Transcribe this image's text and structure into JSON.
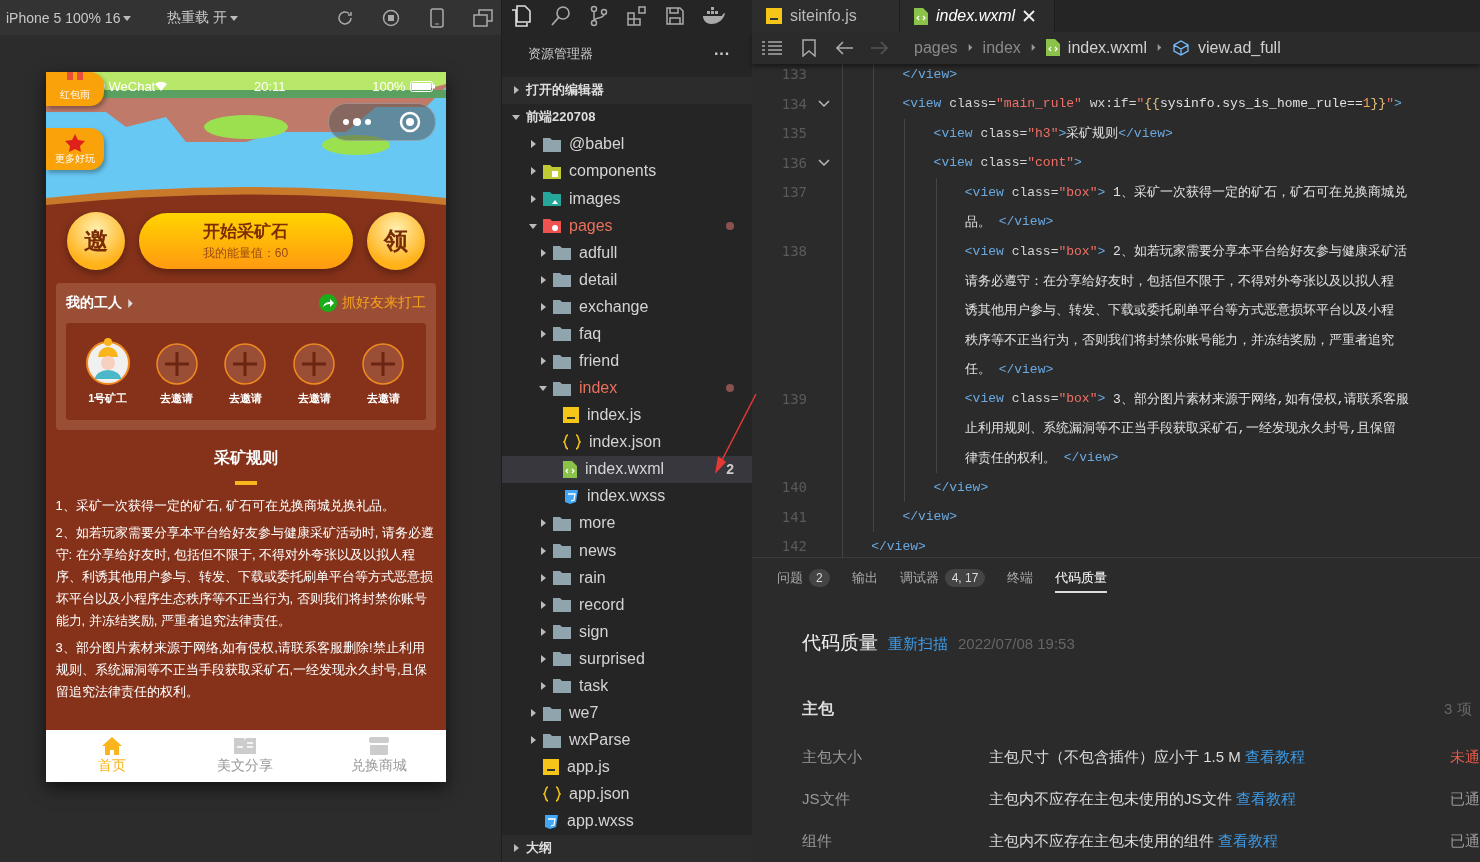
{
  "simulator": {
    "device": "iPhone 5 100% 16",
    "hot_reload": "热重载 开",
    "phone": {
      "status": {
        "carrier": "WeChat",
        "time": "20:11",
        "battery": "100%"
      },
      "badges": [
        {
          "label": "红包雨",
          "kind": "ribbon"
        },
        {
          "label": "更多好玩",
          "kind": "star"
        }
      ],
      "actions": {
        "left": "邀",
        "main": "开始采矿石",
        "energy": "我的能量值：60",
        "right": "领"
      },
      "workers": {
        "title": "我的工人",
        "share": "抓好友来打工",
        "items": [
          {
            "label": "1号矿工",
            "kind": "worker"
          },
          {
            "label": "去邀请",
            "kind": "invite"
          },
          {
            "label": "去邀请",
            "kind": "invite"
          },
          {
            "label": "去邀请",
            "kind": "invite"
          },
          {
            "label": "去邀请",
            "kind": "invite"
          }
        ]
      },
      "rules": {
        "title": "采矿规则",
        "paragraphs": [
          "1、采矿一次获得一定的矿石, 矿石可在兑换商城兑换礼品。",
          "2、如若玩家需要分享本平台给好友参与健康采矿活动时, 请务必遵守: 在分享给好友时, 包括但不限于, 不得对外夸张以及以拟人程序、利诱其他用户参与、转发、下载或委托刷单平台等方式恶意损坏平台以及小程序生态秩序等不正当行为, 否则我们将封禁你账号能力, 并冻结奖励, 严重者追究法律责任。",
          "3、部分图片素材来源于网络,如有侵权,请联系客服删除!禁止利用规则、系统漏洞等不正当手段获取采矿石,一经发现永久封号,且保留追究法律责任的权利。"
        ]
      },
      "tabbar": [
        {
          "label": "首页",
          "kind": "home",
          "selected": true
        },
        {
          "label": "美文分享",
          "kind": "article",
          "selected": false
        },
        {
          "label": "兑换商城",
          "kind": "shop",
          "selected": false
        }
      ]
    }
  },
  "explorer": {
    "title": "资源管理器",
    "more": "···",
    "sections": [
      {
        "label": "打开的编辑器",
        "expanded": false
      },
      {
        "label": "前端220708",
        "expanded": true,
        "children": [
          {
            "name": "@babel",
            "kind": "folder",
            "expanded": false,
            "selected": false
          },
          {
            "name": "components",
            "kind": "folder-components",
            "expanded": false,
            "selected": false
          },
          {
            "name": "images",
            "kind": "folder-images",
            "expanded": false,
            "selected": false
          },
          {
            "name": "pages",
            "kind": "folder-pages",
            "expanded": true,
            "modified": true,
            "selected": false,
            "children": [
              {
                "name": "adfull",
                "kind": "folder",
                "expanded": false,
                "selected": false
              },
              {
                "name": "detail",
                "kind": "folder",
                "expanded": false,
                "selected": false
              },
              {
                "name": "exchange",
                "kind": "folder",
                "expanded": false,
                "selected": false
              },
              {
                "name": "faq",
                "kind": "folder",
                "expanded": false,
                "selected": false
              },
              {
                "name": "friend",
                "kind": "folder",
                "expanded": false,
                "selected": false
              },
              {
                "name": "index",
                "kind": "folder",
                "expanded": true,
                "modified": true,
                "selected": false,
                "children": [
                  {
                    "name": "index.js",
                    "kind": "js",
                    "selected": false
                  },
                  {
                    "name": "index.json",
                    "kind": "json",
                    "selected": false
                  },
                  {
                    "name": "index.wxml",
                    "kind": "wxml",
                    "selected": true,
                    "badge": "2"
                  },
                  {
                    "name": "index.wxss",
                    "kind": "wxss",
                    "selected": false
                  }
                ]
              },
              {
                "name": "more",
                "kind": "folder",
                "expanded": false,
                "selected": false
              },
              {
                "name": "news",
                "kind": "folder",
                "expanded": false,
                "selected": false
              },
              {
                "name": "rain",
                "kind": "folder",
                "expanded": false,
                "selected": false
              },
              {
                "name": "record",
                "kind": "folder",
                "expanded": false,
                "selected": false
              },
              {
                "name": "sign",
                "kind": "folder",
                "expanded": false,
                "selected": false
              },
              {
                "name": "surprised",
                "kind": "folder",
                "expanded": false,
                "selected": false
              },
              {
                "name": "task",
                "kind": "folder",
                "expanded": false,
                "selected": false
              }
            ]
          },
          {
            "name": "we7",
            "kind": "folder",
            "expanded": false,
            "selected": false
          },
          {
            "name": "wxParse",
            "kind": "folder",
            "expanded": false,
            "selected": false
          },
          {
            "name": "app.js",
            "kind": "js",
            "selected": false
          },
          {
            "name": "app.json",
            "kind": "json",
            "selected": false
          },
          {
            "name": "app.wxss",
            "kind": "wxss",
            "selected": false
          }
        ]
      },
      {
        "label": "大纲",
        "expanded": false
      }
    ]
  },
  "editor": {
    "tabs": [
      {
        "label": "siteinfo.js",
        "kind": "js",
        "selected": false
      },
      {
        "label": "index.wxml",
        "kind": "wxml",
        "selected": true
      }
    ],
    "breadcrumb": [
      {
        "label": "pages",
        "kind": "folder"
      },
      {
        "label": "index",
        "kind": "folder"
      },
      {
        "label": "index.wxml",
        "kind": "wxml"
      },
      {
        "label": "view.ad_full",
        "kind": "element"
      }
    ],
    "lines": [
      {
        "number": "133",
        "fold": false,
        "tokens": [
          {
            "kind": "tag",
            "text": "        </view>"
          }
        ]
      },
      {
        "number": "134",
        "fold": true,
        "tokens": [
          {
            "kind": "tag",
            "text": "        <view"
          },
          {
            "kind": "attr",
            "text": " class="
          },
          {
            "kind": "str",
            "text": "\"main_rule\""
          },
          {
            "kind": "attr",
            "text": " wx:if="
          },
          {
            "kind": "str",
            "text": "\""
          },
          {
            "kind": "brace",
            "text": "{{"
          },
          {
            "kind": "text",
            "text": "sysinfo.sys_is_home_rule=="
          },
          {
            "kind": "num",
            "text": "1"
          },
          {
            "kind": "brace",
            "text": "}}"
          },
          {
            "kind": "str",
            "text": "\""
          },
          {
            "kind": "tag",
            "text": ">"
          }
        ]
      },
      {
        "number": "135",
        "fold": false,
        "tokens": [
          {
            "kind": "tag",
            "text": "            <view"
          },
          {
            "kind": "attr",
            "text": " class="
          },
          {
            "kind": "str",
            "text": "\"h3\""
          },
          {
            "kind": "tag",
            "text": ">"
          },
          {
            "kind": "text",
            "text": "采矿规则"
          },
          {
            "kind": "tag",
            "text": "</view>"
          }
        ]
      },
      {
        "number": "136",
        "fold": true,
        "tokens": [
          {
            "kind": "tag",
            "text": "            <view"
          },
          {
            "kind": "attr",
            "text": " class="
          },
          {
            "kind": "str",
            "text": "\"cont\""
          },
          {
            "kind": "tag",
            "text": ">"
          }
        ]
      },
      {
        "number": "137",
        "fold": false,
        "tokens": [
          {
            "kind": "tag",
            "text": "                <view"
          },
          {
            "kind": "attr",
            "text": " class="
          },
          {
            "kind": "str",
            "text": "\"box\""
          },
          {
            "kind": "tag",
            "text": ">"
          },
          {
            "kind": "text",
            "text": " 1、采矿一次获得一定的矿石，矿石可在兑换商城兑"
          }
        ]
      },
      {
        "fold": false,
        "tokens": [
          {
            "kind": "text",
            "text": "                品。 "
          },
          {
            "kind": "tag",
            "text": "</view>"
          }
        ]
      },
      {
        "number": "138",
        "fold": false,
        "tokens": [
          {
            "kind": "tag",
            "text": "                <view"
          },
          {
            "kind": "attr",
            "text": " class="
          },
          {
            "kind": "str",
            "text": "\"box\""
          },
          {
            "kind": "tag",
            "text": ">"
          },
          {
            "kind": "text",
            "text": " 2、如若玩家需要分享本平台给好友参与健康采矿活"
          }
        ]
      },
      {
        "fold": false,
        "tokens": [
          {
            "kind": "text",
            "text": "                请务必遵守：在分享给好友时，包括但不限于，不得对外夸张以及以拟人程"
          }
        ]
      },
      {
        "fold": false,
        "tokens": [
          {
            "kind": "text",
            "text": "                诱其他用户参与、转发、下载或委托刷单平台等方式恶意损坏平台以及小程"
          }
        ]
      },
      {
        "fold": false,
        "tokens": [
          {
            "kind": "text",
            "text": "                秩序等不正当行为，否则我们将封禁你账号能力，并冻结奖励，严重者追究"
          }
        ]
      },
      {
        "fold": false,
        "tokens": [
          {
            "kind": "text",
            "text": "                任。 "
          },
          {
            "kind": "tag",
            "text": "</view>"
          }
        ]
      },
      {
        "number": "139",
        "fold": false,
        "tokens": [
          {
            "kind": "tag",
            "text": "                <view"
          },
          {
            "kind": "attr",
            "text": " class="
          },
          {
            "kind": "str",
            "text": "\"box\""
          },
          {
            "kind": "tag",
            "text": ">"
          },
          {
            "kind": "text",
            "text": " 3、部分图片素材来源于网络,如有侵权,请联系客服"
          }
        ]
      },
      {
        "fold": false,
        "tokens": [
          {
            "kind": "text",
            "text": "                止利用规则、系统漏洞等不正当手段获取采矿石,一经发现永久封号,且保留"
          }
        ]
      },
      {
        "fold": false,
        "tokens": [
          {
            "kind": "text",
            "text": "                律责任的权利。 "
          },
          {
            "kind": "tag",
            "text": "</view>"
          }
        ]
      },
      {
        "number": "140",
        "fold": false,
        "tokens": [
          {
            "kind": "tag",
            "text": "            </view>"
          }
        ]
      },
      {
        "number": "141",
        "fold": false,
        "tokens": [
          {
            "kind": "tag",
            "text": "        </view>"
          }
        ]
      },
      {
        "number": "142",
        "fold": false,
        "tokens": [
          {
            "kind": "tag",
            "text": "    </view>"
          }
        ]
      }
    ]
  },
  "panel": {
    "tabs": [
      {
        "label": "问题",
        "count": "2",
        "selected": false
      },
      {
        "label": "输出",
        "selected": false
      },
      {
        "label": "调试器",
        "count": "4, 17",
        "selected": false
      },
      {
        "label": "终端",
        "selected": false
      },
      {
        "label": "代码质量",
        "selected": true
      }
    ],
    "title": "代码质量",
    "rescan": "重新扫描",
    "time": "2022/07/08 19:53",
    "group": {
      "title": "主包",
      "count": "3 项"
    },
    "rows": [
      {
        "name": "主包大小",
        "desc": "主包尺寸（不包含插件）应小于 1.5 M",
        "link": "查看教程",
        "status": "未通",
        "passed": false
      },
      {
        "name": "JS文件",
        "desc": "主包内不应存在主包未使用的JS文件",
        "link": "查看教程",
        "status": "已通",
        "passed": true
      },
      {
        "name": "组件",
        "desc": "主包内不应存在主包未使用的组件",
        "link": "查看教程",
        "status": "已通",
        "passed": true
      }
    ]
  }
}
